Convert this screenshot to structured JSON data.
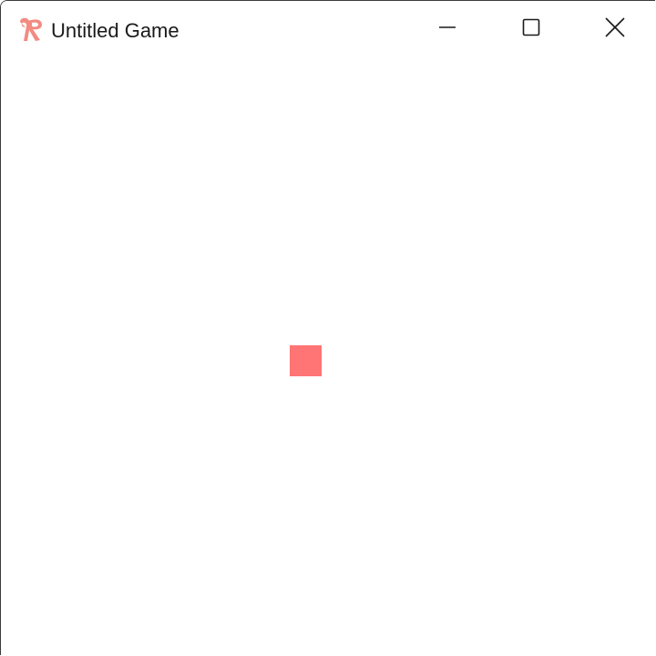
{
  "window": {
    "title": "Untitled Game",
    "app_icon": "ribbon-r-logo-icon",
    "controls": {
      "minimize_icon": "minimize-icon",
      "maximize_icon": "maximize-icon",
      "close_icon": "close-icon"
    }
  },
  "game": {
    "background_color": "#ffffff",
    "player": {
      "shape": "square",
      "color": "#ff7474"
    }
  },
  "colors": {
    "logo": "#f28b82",
    "titlebar_text": "#1a1a1a",
    "window_border": "#3a3a3a"
  }
}
